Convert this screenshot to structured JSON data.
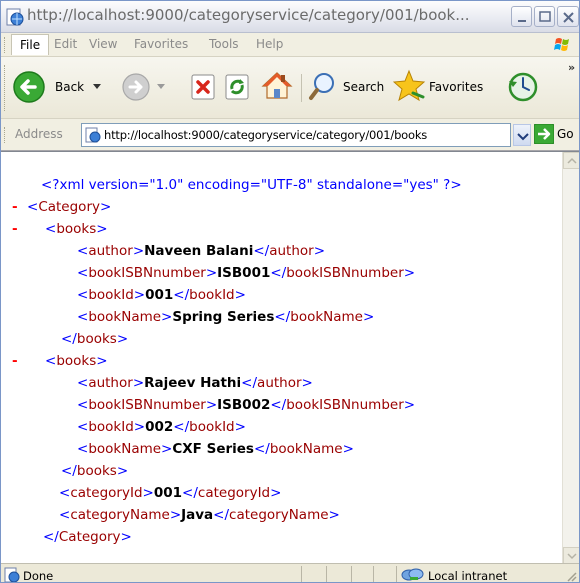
{
  "window": {
    "title": "http://localhost:9000/categoryservice/category/001/book..."
  },
  "menubar": {
    "items": [
      "File",
      "Edit",
      "View",
      "Favorites",
      "Tools",
      "Help"
    ]
  },
  "toolbar": {
    "back_label": "Back",
    "search_label": "Search",
    "favorites_label": "Favorites",
    "more_chevron": "»"
  },
  "address": {
    "label": "Address",
    "url": "http://localhost:9000/categoryservice/category/001/books",
    "go_label": "Go"
  },
  "document": {
    "declaration": "<?xml version=\"1.0\" encoding=\"UTF-8\" standalone=\"yes\" ?>",
    "collapse_symbol": "-",
    "root_tag": "Category",
    "books": [
      {
        "tag": "books",
        "fields": [
          {
            "tag": "author",
            "value": "Naveen Balani"
          },
          {
            "tag": "bookISBNnumber",
            "value": "ISB001"
          },
          {
            "tag": "bookId",
            "value": "001"
          },
          {
            "tag": "bookName",
            "value": "Spring Series"
          }
        ]
      },
      {
        "tag": "books",
        "fields": [
          {
            "tag": "author",
            "value": "Rajeev Hathi"
          },
          {
            "tag": "bookISBNnumber",
            "value": "ISB002"
          },
          {
            "tag": "bookId",
            "value": "002"
          },
          {
            "tag": "bookName",
            "value": "CXF Series"
          }
        ]
      }
    ],
    "category_fields": [
      {
        "tag": "categoryId",
        "value": "001"
      },
      {
        "tag": "categoryName",
        "value": "Java"
      }
    ]
  },
  "statusbar": {
    "status": "Done",
    "zone": "Local intranet"
  },
  "colors": {
    "pi": "#0000ff",
    "bracket": "#0000ff",
    "tag": "#990000",
    "collapse": "#ff0000"
  }
}
